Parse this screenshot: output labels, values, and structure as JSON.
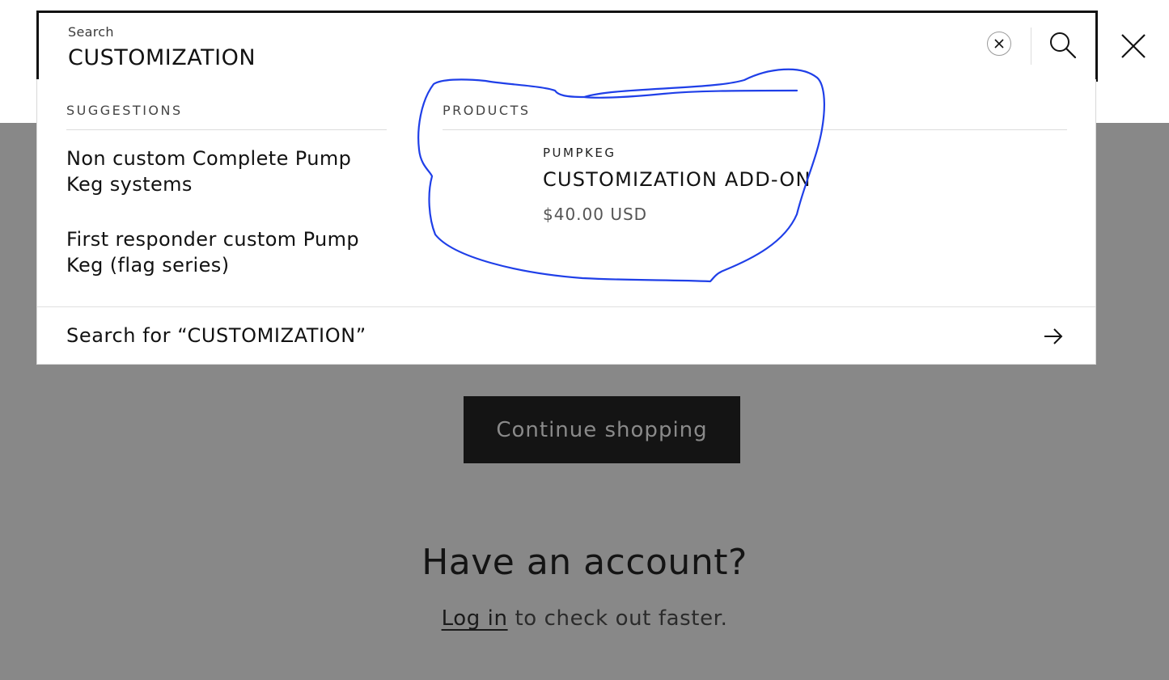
{
  "search": {
    "label": "Search",
    "value": "CUSTOMIZATION",
    "clear_label": "×"
  },
  "suggestions": {
    "heading": "SUGGESTIONS",
    "items": [
      "Non custom Complete Pump Keg systems",
      "First responder custom Pump Keg (flag series)"
    ]
  },
  "products": {
    "heading": "PRODUCTS",
    "items": [
      {
        "vendor": "PUMPKEG",
        "title": "CUSTOMIZATION ADD-ON",
        "price": "$40.00 USD"
      }
    ]
  },
  "search_for": {
    "label": "Search for “CUSTOMIZATION”"
  },
  "page": {
    "continue_label": "Continue shopping",
    "account_heading": "Have an account?",
    "login_link": "Log in",
    "login_suffix": " to check out faster."
  },
  "colors": {
    "overlay": "#888888",
    "annotation": "#1f3fe8",
    "button_bg": "#141414"
  }
}
